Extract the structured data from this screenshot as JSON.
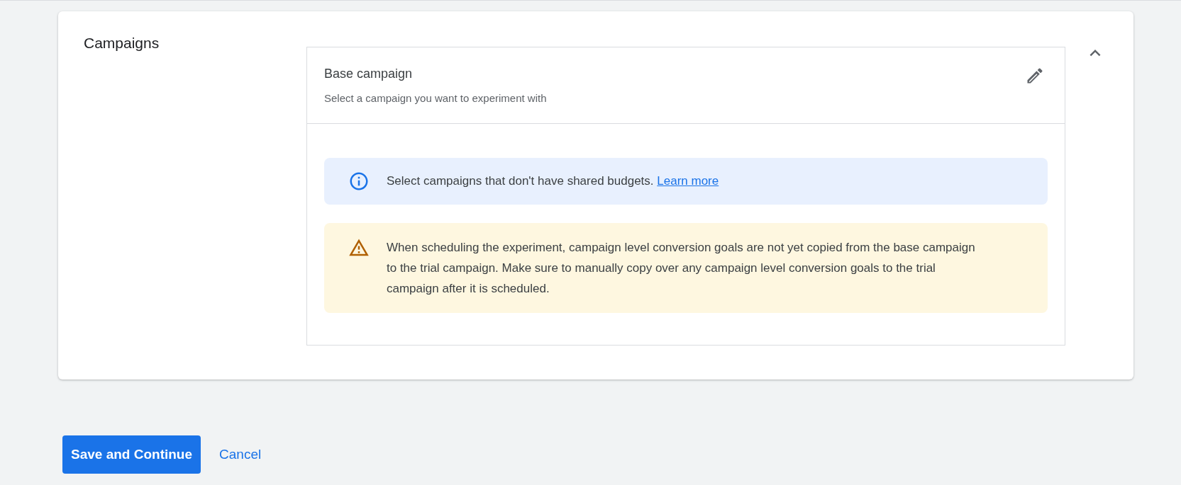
{
  "section": {
    "title": "Campaigns",
    "expanded": true
  },
  "base_campaign": {
    "title": "Base campaign",
    "subtitle": "Select a campaign you want to experiment with"
  },
  "messages": [
    {
      "kind": "info",
      "text": "Select campaigns that don't have shared budgets.",
      "link": "Learn more"
    },
    {
      "kind": "warning",
      "text": "When scheduling the experiment, campaign level conversion goals are not yet copied from the base campaign to the trial campaign. Make sure to manually copy over any campaign level conversion goals to the trial campaign after it is scheduled."
    }
  ],
  "buttons": {
    "primary": "Save and Continue",
    "secondary": "Cancel"
  }
}
